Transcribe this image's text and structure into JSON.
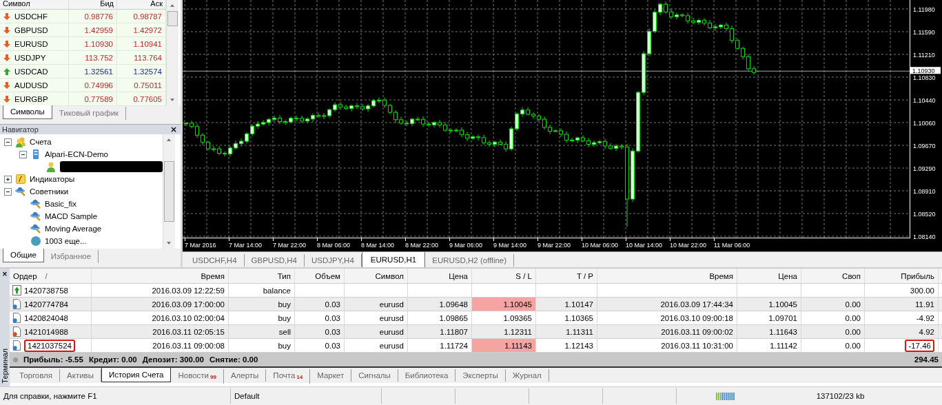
{
  "market_watch": {
    "columns": [
      "Символ",
      "Бид",
      "Аск"
    ],
    "rows": [
      {
        "symbol": "USDCHF",
        "bid": "0.98776",
        "ask": "0.98787",
        "rising": false
      },
      {
        "symbol": "GBPUSD",
        "bid": "1.42959",
        "ask": "1.42972",
        "rising": false
      },
      {
        "symbol": "EURUSD",
        "bid": "1.10930",
        "ask": "1.10941",
        "rising": false
      },
      {
        "symbol": "USDJPY",
        "bid": "113.752",
        "ask": "113.764",
        "rising": false
      },
      {
        "symbol": "USDCAD",
        "bid": "1.32561",
        "ask": "1.32574",
        "rising": true
      },
      {
        "symbol": "AUDUSD",
        "bid": "0.74996",
        "ask": "0.75011",
        "rising": false
      },
      {
        "symbol": "EURGBP",
        "bid": "0.77589",
        "ask": "0.77605",
        "rising": false
      }
    ],
    "tabs": [
      {
        "label": "Символы",
        "selected": true
      },
      {
        "label": "Тиковый график",
        "selected": false
      }
    ]
  },
  "navigator": {
    "title": "Навигатор",
    "close": "×",
    "tree": [
      {
        "label": "Счета",
        "kind": "accounts",
        "expanded": true,
        "children": [
          {
            "label": "Alpari-ECN-Demo",
            "kind": "server",
            "expanded": true,
            "children": [
              {
                "kind": "user",
                "redacted": true
              }
            ]
          }
        ]
      },
      {
        "label": "Индикаторы",
        "kind": "indicators",
        "expanded": false
      },
      {
        "label": "Советники",
        "kind": "experts",
        "expanded": true,
        "children": [
          {
            "label": "Basic_fix",
            "kind": "expert"
          },
          {
            "label": "MACD Sample",
            "kind": "expert"
          },
          {
            "label": "Moving Average",
            "kind": "expert"
          },
          {
            "label": "1003 еще...",
            "kind": "more"
          }
        ]
      }
    ],
    "tabs": [
      {
        "label": "Общие",
        "selected": true
      },
      {
        "label": "Избранное",
        "selected": false
      }
    ]
  },
  "chart": {
    "price_labels": [
      "1.11980",
      "1.11590",
      "1.11210",
      "1.10830",
      "1.10440",
      "1.10060",
      "1.09670",
      "1.09290",
      "1.08910",
      "1.08520",
      "1.08140"
    ],
    "current_price": "1.10930",
    "time_labels": [
      "7 Mar 2016",
      "7 Mar 14:00",
      "7 Mar 22:00",
      "8 Mar 06:00",
      "8 Mar 14:00",
      "8 Mar 22:00",
      "9 Mar 06:00",
      "9 Mar 14:00",
      "9 Mar 22:00",
      "10 Mar 06:00",
      "10 Mar 14:00",
      "10 Mar 22:00",
      "11 Mar 06:00"
    ]
  },
  "chart_tabs": [
    {
      "label": "USDCHF,H4",
      "selected": false
    },
    {
      "label": "GBPUSD,H4",
      "selected": false
    },
    {
      "label": "USDJPY,H4",
      "selected": false
    },
    {
      "label": "EURUSD,H1",
      "selected": true
    },
    {
      "label": "EURUSD,H2 (offline)",
      "selected": false
    }
  ],
  "terminal": {
    "title": "Терминал",
    "close": "×",
    "sort_mark": "/",
    "columns": [
      "Ордер",
      "Время",
      "Тип",
      "Объем",
      "Символ",
      "Цена",
      "S / L",
      "T / P",
      "Время",
      "Цена",
      "Своп",
      "Прибыль"
    ],
    "rows": [
      {
        "kind": "balance",
        "order": "1420738758",
        "open_time": "2016.03.09 12:22:59",
        "type": "balance",
        "profit": "300.00",
        "sl_hit": false,
        "order_circled": false,
        "profit_circled": false
      },
      {
        "kind": "buy",
        "order": "1420774784",
        "open_time": "2016.03.09 17:00:00",
        "type": "buy",
        "volume": "0.03",
        "symbol": "eurusd",
        "price": "1.09648",
        "sl": "1.10045",
        "tp": "1.10147",
        "close_time": "2016.03.09 17:44:34",
        "close_price": "1.10045",
        "swap": "0.00",
        "profit": "11.91",
        "sl_hit": true,
        "order_circled": false,
        "profit_circled": false
      },
      {
        "kind": "buy",
        "order": "1420824048",
        "open_time": "2016.03.10 02:00:04",
        "type": "buy",
        "volume": "0.03",
        "symbol": "eurusd",
        "price": "1.09865",
        "sl": "1.09365",
        "tp": "1.10365",
        "close_time": "2016.03.10 09:00:18",
        "close_price": "1.09701",
        "swap": "0.00",
        "profit": "-4.92",
        "sl_hit": false,
        "order_circled": false,
        "profit_circled": false
      },
      {
        "kind": "sell",
        "order": "1421014988",
        "open_time": "2016.03.11 02:05:15",
        "type": "sell",
        "volume": "0.03",
        "symbol": "eurusd",
        "price": "1.11807",
        "sl": "1.12311",
        "tp": "1.11311",
        "close_time": "2016.03.11 09:00:02",
        "close_price": "1.11643",
        "swap": "0.00",
        "profit": "4.92",
        "sl_hit": false,
        "order_circled": false,
        "profit_circled": false
      },
      {
        "kind": "buy",
        "order": "1421037524",
        "open_time": "2016.03.11 09:00:08",
        "type": "buy",
        "volume": "0.03",
        "symbol": "eurusd",
        "price": "1.11724",
        "sl": "1.11143",
        "tp": "1.12143",
        "close_time": "2016.03.11 10:31:00",
        "close_price": "1.11142",
        "swap": "0.00",
        "profit": "-17.46",
        "sl_hit": true,
        "order_circled": true,
        "profit_circled": true
      }
    ],
    "summary": {
      "items": [
        "Прибыль: -5.55",
        "Кредит: 0.00",
        "Депозит: 300.00",
        "Снятие: 0.00"
      ],
      "total": "294.45"
    },
    "tabs": [
      {
        "label": "Торговля",
        "selected": false
      },
      {
        "label": "Активы",
        "selected": false
      },
      {
        "label": "История Счета",
        "selected": true
      },
      {
        "label": "Новости",
        "badge": "99",
        "selected": false
      },
      {
        "label": "Алерты",
        "selected": false
      },
      {
        "label": "Почта",
        "badge": "14",
        "selected": false
      },
      {
        "label": "Маркет",
        "selected": false
      },
      {
        "label": "Сигналы",
        "selected": false
      },
      {
        "label": "Библиотека",
        "selected": false
      },
      {
        "label": "Эксперты",
        "selected": false
      },
      {
        "label": "Журнал",
        "selected": false
      }
    ]
  },
  "status_bar": {
    "help": "Для справки, нажмите F1",
    "profile": "Default",
    "traffic": "137102/23 kb"
  }
}
